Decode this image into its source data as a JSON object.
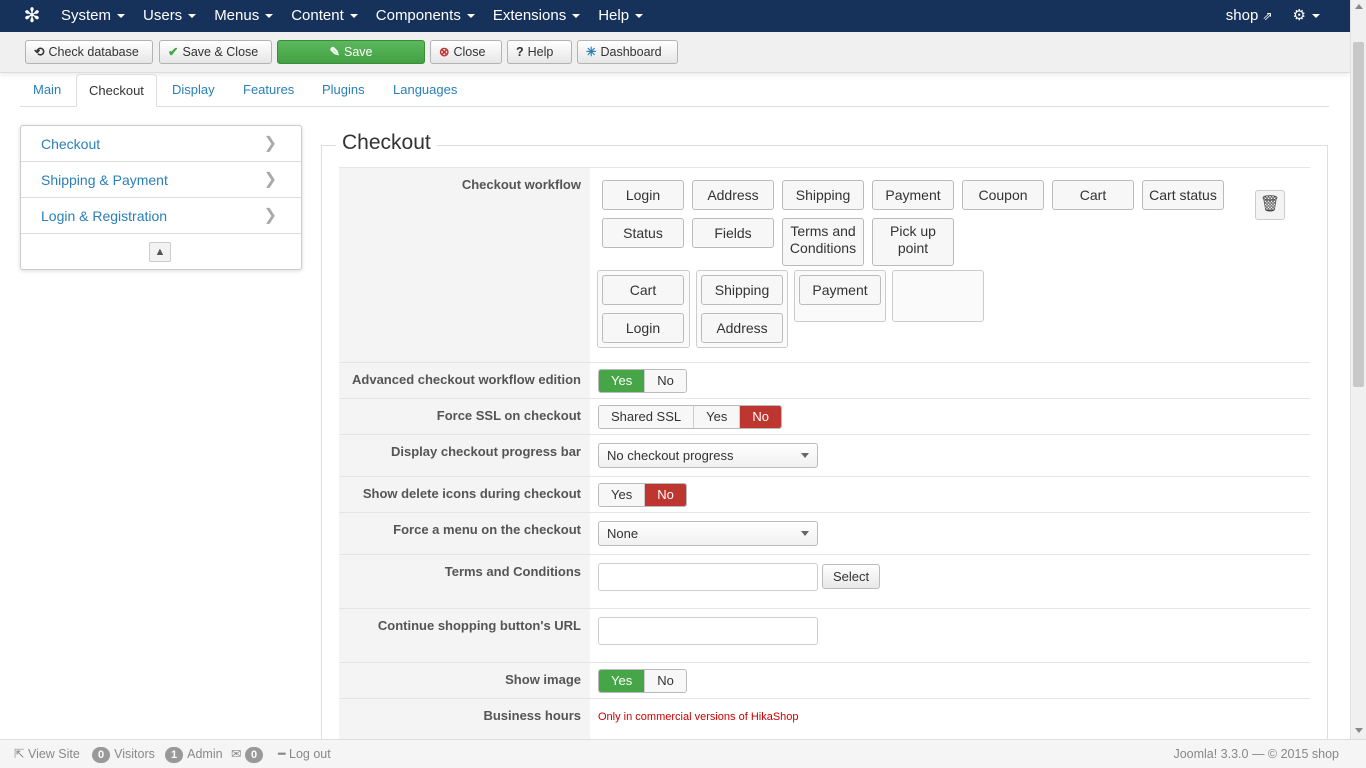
{
  "topnav": {
    "menu": [
      "System",
      "Users",
      "Menus",
      "Content",
      "Components",
      "Extensions",
      "Help"
    ],
    "site": "shop",
    "accent": "#17325a"
  },
  "toolbar": {
    "check_db": "Check database",
    "save_close": "Save & Close",
    "save": "Save",
    "close": "Close",
    "help": "Help",
    "dashboard": "Dashboard"
  },
  "tabs": [
    "Main",
    "Checkout",
    "Display",
    "Features",
    "Plugins",
    "Languages"
  ],
  "active_tab": "Checkout",
  "sidebar": {
    "items": [
      "Checkout",
      "Shipping & Payment",
      "Login & Registration"
    ]
  },
  "section": {
    "title": "Checkout",
    "workflow_label": "Checkout workflow",
    "workflow_palette": [
      "Login",
      "Address",
      "Shipping",
      "Payment",
      "Coupon",
      "Cart",
      "Cart status",
      "Status",
      "Fields",
      "Terms and Conditions",
      "Pick up point"
    ],
    "workflow_groups": [
      [
        "Cart",
        "Login"
      ],
      [
        "Shipping",
        "Address"
      ],
      [
        "Payment"
      ],
      []
    ],
    "rows": {
      "advanced_label": "Advanced checkout workflow edition",
      "advanced_options": [
        "Yes",
        "No"
      ],
      "ssl_label": "Force SSL on checkout",
      "ssl_options": [
        "Shared SSL",
        "Yes",
        "No"
      ],
      "progress_label": "Display checkout progress bar",
      "progress_value": "No checkout progress",
      "delete_label": "Show delete icons during checkout",
      "delete_options": [
        "Yes",
        "No"
      ],
      "menu_label": "Force a menu on the checkout",
      "menu_value": "None",
      "terms_label": "Terms and Conditions",
      "terms_select": "Select",
      "continue_label": "Continue shopping button's URL",
      "image_label": "Show image",
      "image_options": [
        "Yes",
        "No"
      ],
      "hours_label": "Business hours",
      "hours_note": "Only in commercial versions of HikaShop"
    }
  },
  "statusbar": {
    "view_site": "View Site",
    "visitors_count": "0",
    "visitors": "Visitors",
    "admin_count": "1",
    "admin": "Admin",
    "messages_count": "0",
    "logout": "Log out",
    "version": "Joomla! 3.3.0 — © 2015 shop"
  }
}
